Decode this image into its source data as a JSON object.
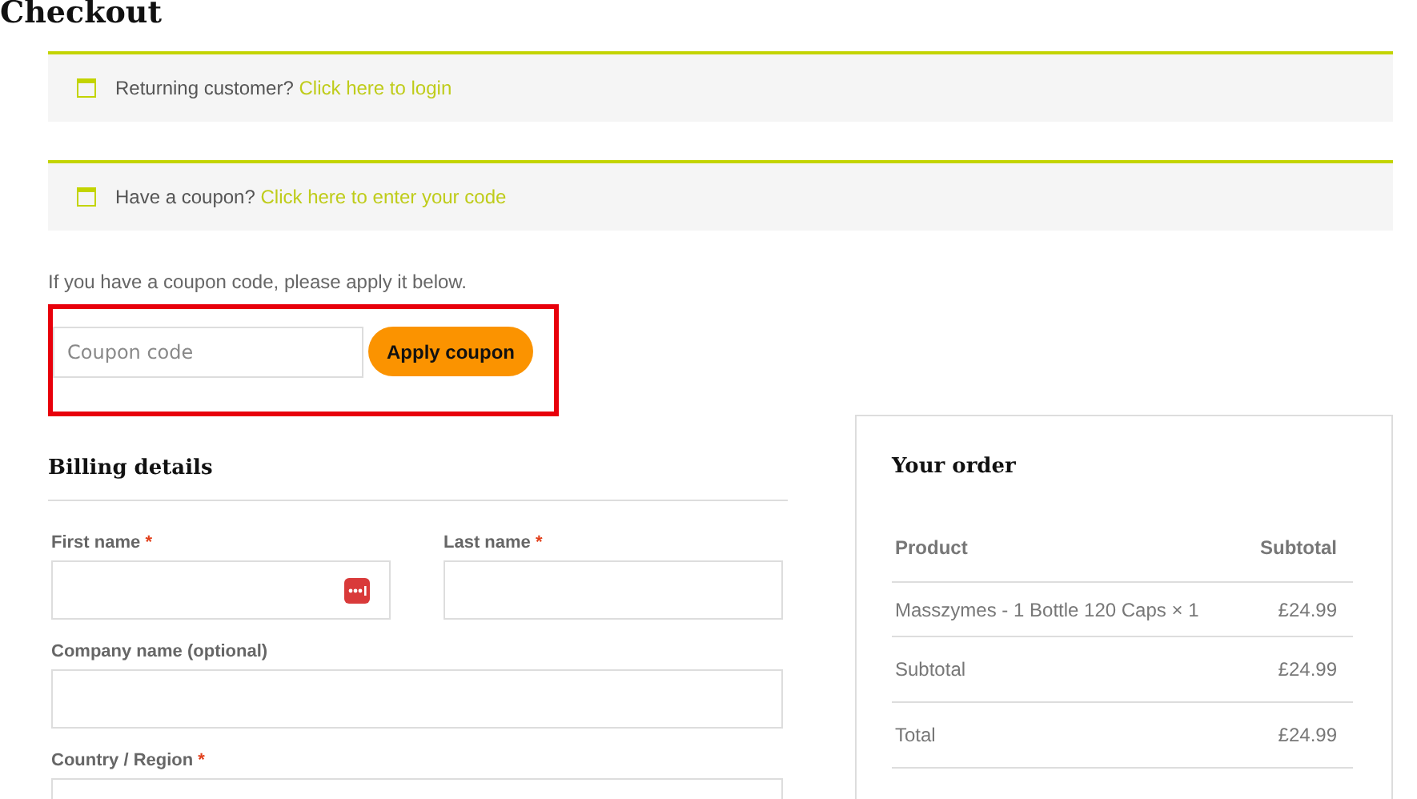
{
  "title": "Checkout",
  "notices": [
    {
      "text": "Returning customer?",
      "link": "Click here to login"
    },
    {
      "text": "Have a coupon?",
      "link": "Click here to enter your code"
    }
  ],
  "coupon": {
    "hint": "If you have a coupon code, please apply it below.",
    "placeholder": "Coupon code",
    "button": "Apply coupon",
    "highlighted": true
  },
  "billing": {
    "title": "Billing details",
    "fields": [
      {
        "label": "First name",
        "required_mark": "*",
        "kind": "half",
        "autofill_icon": true
      },
      {
        "label": "Last name",
        "required_mark": "*",
        "kind": "half"
      },
      {
        "label": "Company name (optional)",
        "kind": "full"
      },
      {
        "label": "Country / Region",
        "required_mark": "*",
        "kind": "full"
      }
    ]
  },
  "order": {
    "title": "Your order",
    "columns": [
      "Product",
      "Subtotal"
    ],
    "rows": [
      {
        "label": "Masszymes - 1 Bottle 120 Caps × 1",
        "value": "£24.99"
      },
      {
        "label": "Subtotal",
        "value": "£24.99"
      },
      {
        "label": "Total",
        "value": "£24.99"
      }
    ]
  }
}
